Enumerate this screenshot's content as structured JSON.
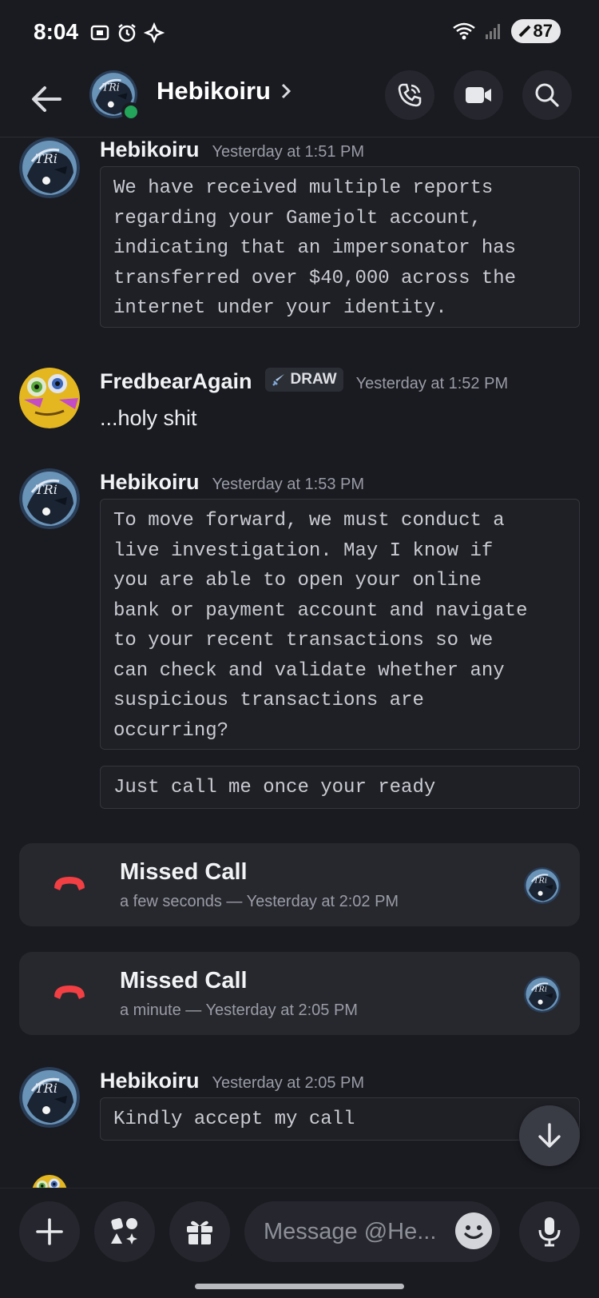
{
  "status_bar": {
    "time": "8:04",
    "battery": "87",
    "signal_label": "5"
  },
  "header": {
    "title": "Hebikoiru"
  },
  "messages": [
    {
      "username": "Hebikoiru",
      "timestamp": "Yesterday at 1:51 PM",
      "code": "We have received multiple reports\nregarding your Gamejolt account,\nindicating that an impersonator has\ntransferred over $40,000 across the\ninternet under your identity."
    },
    {
      "username": "FredbearAgain",
      "tag": "DRAW",
      "timestamp": "Yesterday at 1:52 PM",
      "text": "...holy shit"
    },
    {
      "username": "Hebikoiru",
      "timestamp": "Yesterday at 1:53 PM",
      "code": "To move forward, we must conduct a\nlive investigation. May I know if\nyou are able to open your online\nbank or payment account and navigate\nto your recent transactions so we\ncan check and validate whether any\nsuspicious transactions are\noccurring?",
      "code2": "Just call me once your ready"
    },
    {
      "username": "Hebikoiru",
      "timestamp": "Yesterday at 2:05 PM",
      "code": "Kindly accept my call"
    }
  ],
  "calls": [
    {
      "title": "Missed Call",
      "subtitle": "a few seconds — Yesterday at 2:02 PM"
    },
    {
      "title": "Missed Call",
      "subtitle": "a minute — Yesterday at 2:05 PM"
    }
  ],
  "composer": {
    "placeholder": "Message @He..."
  },
  "colors": {
    "missed_call_red": "#f23f43",
    "online_green": "#23a55a"
  }
}
